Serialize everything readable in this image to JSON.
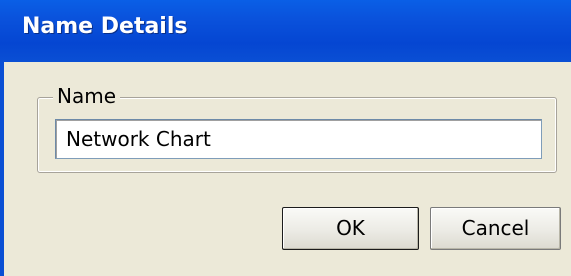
{
  "window": {
    "title": "Name Details"
  },
  "group": {
    "label": "Name"
  },
  "name_field": {
    "value": "Network Chart"
  },
  "buttons": {
    "ok_label": "OK",
    "cancel_label": "Cancel"
  },
  "colors": {
    "titlebar": "#0a4fd4",
    "dialog_background": "#ece9d8"
  }
}
